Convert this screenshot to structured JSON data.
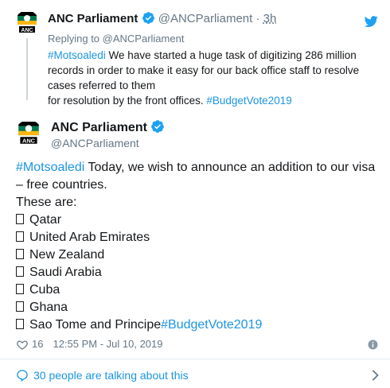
{
  "parent_tweet": {
    "name": "ANC Parliament",
    "handle": "@ANCParliament",
    "separator": "·",
    "time": "3h",
    "replying_prefix": "Replying to ",
    "replying_to": "@ANCParliament",
    "hashtag_open": "#Motsoaledi",
    "line1_rest": " We have started a huge task of digitizing 286 million",
    "line2": "records in order to make it easy for our back office staff to resolve",
    "line3": "cases referred to them",
    "line4_text": "for resolution by the front offices. ",
    "hashtag_close": "#BudgetVote2019"
  },
  "main_tweet": {
    "name": "ANC Parliament",
    "handle": "@ANCParliament",
    "hashtag_open": "#Motsoaledi",
    "intro_rest": " Today, we wish to announce an addition to our visa",
    "intro_line2": "– free countries.",
    "these_are": "These are:",
    "countries": [
      "Qatar",
      "United Arab Emirates",
      "New Zealand",
      "Saudi Arabia",
      "Cuba",
      "Ghana",
      "Sao Tome and Principe"
    ],
    "hashtag_close": "#BudgetVote2019",
    "likes": "16",
    "timestamp": "12:55 PM - Jul 10, 2019"
  },
  "footer": {
    "talking": "30 people are talking about this"
  },
  "colors": {
    "link": "#1b95e0",
    "verified": "#1da1f2",
    "twitter": "#1da1f2",
    "muted": "#657786",
    "anc_green": "#007a4d",
    "anc_gold": "#ffb612"
  },
  "icons": [
    "anc-logo-icon",
    "verified-badge-icon",
    "twitter-bird-icon",
    "heart-icon",
    "info-icon",
    "comment-icon",
    "chevron-right-icon"
  ]
}
